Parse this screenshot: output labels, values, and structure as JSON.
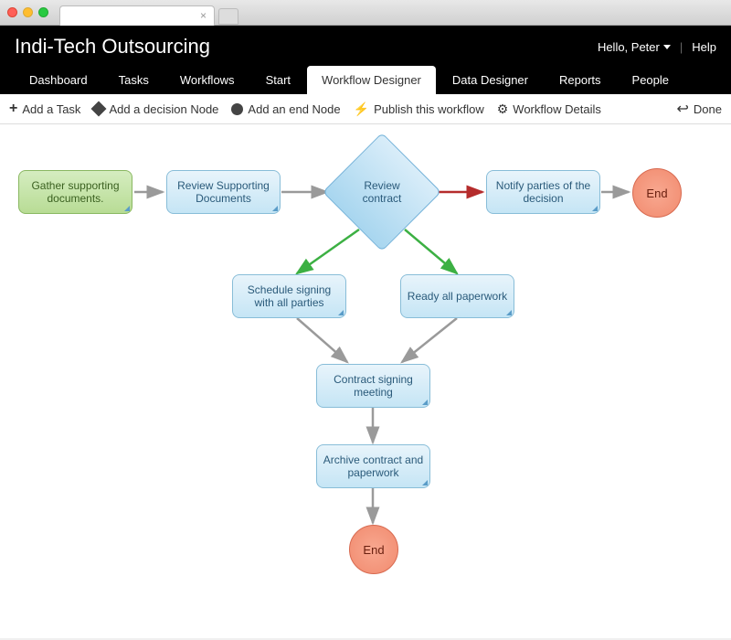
{
  "header": {
    "title": "Indi-Tech Outsourcing",
    "greeting": "Hello, Peter",
    "help": "Help"
  },
  "nav": {
    "items": [
      "Dashboard",
      "Tasks",
      "Workflows",
      "Start",
      "Workflow Designer",
      "Data Designer",
      "Reports",
      "People"
    ],
    "active_index": 4
  },
  "toolbar": {
    "add_task": "Add a Task",
    "add_decision": "Add a decision Node",
    "add_end": "Add an end Node",
    "publish": "Publish this workflow",
    "details": "Workflow Details",
    "done": "Done"
  },
  "nodes": {
    "gather": "Gather supporting documents.",
    "review_docs": "Review Supporting Documents",
    "review_contract": "Review contract",
    "notify": "Notify parties of the decision",
    "end1": "End",
    "schedule": "Schedule signing with all parties",
    "ready": "Ready all paperwork",
    "meeting": "Contract signing meeting",
    "archive": "Archive contract and paperwork",
    "end2": "End"
  },
  "colors": {
    "arrow_gray": "#9a9a9a",
    "arrow_green": "#3cb043",
    "arrow_red": "#b52c2c"
  }
}
